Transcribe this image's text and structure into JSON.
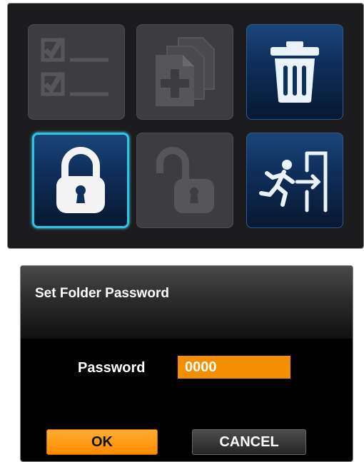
{
  "menu": {
    "tiles": [
      {
        "icon": "checklist-icon",
        "state": "disabled"
      },
      {
        "icon": "add-copy-icon",
        "state": "disabled"
      },
      {
        "icon": "trash-icon",
        "state": "enabled"
      },
      {
        "icon": "locked-padlock-icon",
        "state": "selected"
      },
      {
        "icon": "unlocked-padlock-icon",
        "state": "disabled"
      },
      {
        "icon": "exit-icon",
        "state": "enabled"
      }
    ]
  },
  "dialog": {
    "title": "Set Folder Password",
    "password_label": "Password",
    "password_value": "0000",
    "ok_label": "OK",
    "cancel_label": "CANCEL"
  },
  "colors": {
    "accent_orange": "#f28e00",
    "selection_cyan": "#2ec4e8",
    "tile_blue": "#0e2d58",
    "tile_disabled": "#3d3d3f",
    "disabled_icon": "#565658",
    "icon_light": "#e8f3fb"
  }
}
